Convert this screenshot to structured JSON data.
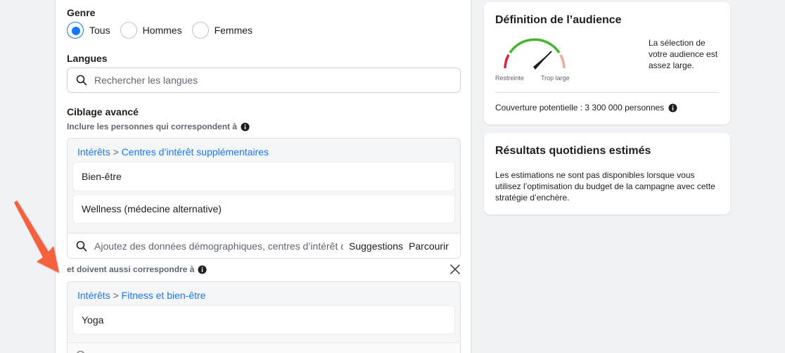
{
  "gender": {
    "label": "Genre",
    "options": [
      {
        "label": "Tous",
        "checked": true
      },
      {
        "label": "Hommes",
        "checked": false
      },
      {
        "label": "Femmes",
        "checked": false
      }
    ]
  },
  "languages": {
    "label": "Langues",
    "search_placeholder": "Rechercher les langues"
  },
  "advanced_targeting": {
    "label": "Ciblage avancé",
    "include_label": "Inclure les personnes qui correspondent à",
    "group1": {
      "breadcrumb_root": "Intérêts",
      "breadcrumb_sep": ">",
      "breadcrumb_leaf": "Centres d’intérêt supplémentaires",
      "items": [
        "Bien-être",
        "Wellness (médecine alternative)"
      ],
      "search_placeholder": "Ajoutez des données démographiques, centres d’intérêt o",
      "suggestions_label": "Suggestions",
      "browse_label": "Parcourir"
    },
    "narrow_label": "et doivent aussi correspondre à",
    "group2": {
      "breadcrumb_root": "Intérêts",
      "breadcrumb_sep": ">",
      "breadcrumb_leaf": "Fitness et bien-être",
      "items": [
        "Yoga"
      ]
    }
  },
  "audience_card": {
    "title": "Définition de l’audience",
    "gauge_min_label": "Restreinte",
    "gauge_max_label": "Trop large",
    "description": "La sélection de votre audience est assez large.",
    "reach": "Couverture potentielle : 3 300 000 personnes"
  },
  "results_card": {
    "title": "Résultats quotidiens estimés",
    "description": "Les estimations ne sont pas disponibles lorsque vous utilisez l’optimisation du budget de la campagne avec cette stratégie d’enchère."
  },
  "colors": {
    "accent": "#1877f2",
    "gauge_green": "#42b72a",
    "gauge_red": "#e41e3f",
    "gauge_pink": "#f1a99d",
    "annotation_arrow": "#f5603d"
  }
}
